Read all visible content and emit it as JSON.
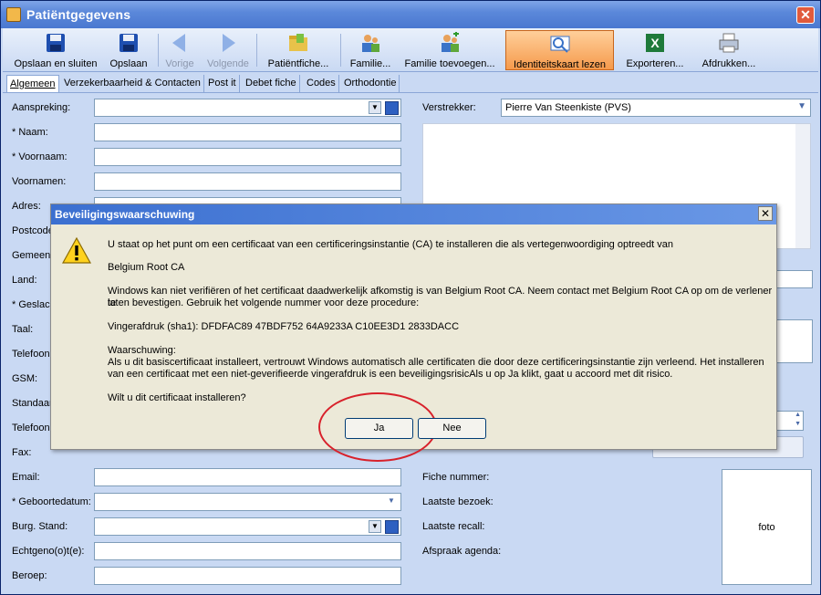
{
  "window": {
    "title": "Patiëntgegevens"
  },
  "toolbar": {
    "buttons": [
      {
        "label": "Opslaan en sluiten"
      },
      {
        "label": "Opslaan"
      },
      {
        "label": "Vorige"
      },
      {
        "label": "Volgende"
      },
      {
        "label": "Patiëntfiche..."
      },
      {
        "label": "Familie..."
      },
      {
        "label": "Familie toevoegen..."
      },
      {
        "label": "Identiteitskaart lezen"
      },
      {
        "label": "Exporteren..."
      },
      {
        "label": "Afdrukken..."
      }
    ]
  },
  "tabs": [
    "Algemeen",
    "Verzekerbaarheid & Contacten",
    "Post it",
    "Debet fiche",
    "Codes",
    "Orthodontie"
  ],
  "left_form": {
    "labels": [
      "Aanspreking:",
      "* Naam:",
      "* Voornaam:",
      "Voornamen:",
      "Adres:",
      "Postcode",
      "Gemeent",
      "Land:",
      "* Geslach",
      "Taal:",
      "Telefoon",
      "GSM:",
      "Standaar",
      "Telefoon",
      "Fax:",
      "Email:",
      "* Geboortedatum:",
      "Burg. Stand:",
      "Echtgeno(o)t(e):",
      "Beroep:"
    ]
  },
  "right_form": {
    "verstrekker_label": "Verstrekker:",
    "verstrekker_value": "Pierre Van Steenkiste (PVS)",
    "labels": [
      "Fiche nummer:",
      "Laatste bezoek:",
      "Laatste recall:",
      "Afspraak agenda:"
    ],
    "foto_label": "foto"
  },
  "dialog": {
    "title": "Beveiligingswaarschuwing",
    "line1": "U staat op het punt om een certificaat van een certificeringsinstantie (CA) te installeren die als vertegenwoordiging optreedt van",
    "ca_name": "Belgium Root CA",
    "para2a": "Windows kan niet verifiëren of het certificaat daadwerkelijk afkomstig is van Belgium Root CA. Neem contact met Belgium Root CA op om de verlener te",
    "para2b": "laten bevestigen. Gebruik het volgende nummer voor deze procedure:",
    "thumbprint": "Vingerafdruk (sha1): DFDFAC89 47BDF752 64A9233A C10EE3D1 2833DACC",
    "warn_head": "Waarschuwing:",
    "warn_a": "Als u dit basiscertificaat installeert, vertrouwt Windows automatisch alle certificaten die door deze certificeringsinstantie zijn verleend. Het installeren",
    "warn_b": "van een certificaat met een niet-geverifieerde vingerafdruk is een beveiligingsrisicAls u op Ja klikt, gaat u accoord met dit risico.",
    "question": "Wilt u dit certificaat installeren?",
    "yes_label": "Ja",
    "no_label": "Nee"
  }
}
